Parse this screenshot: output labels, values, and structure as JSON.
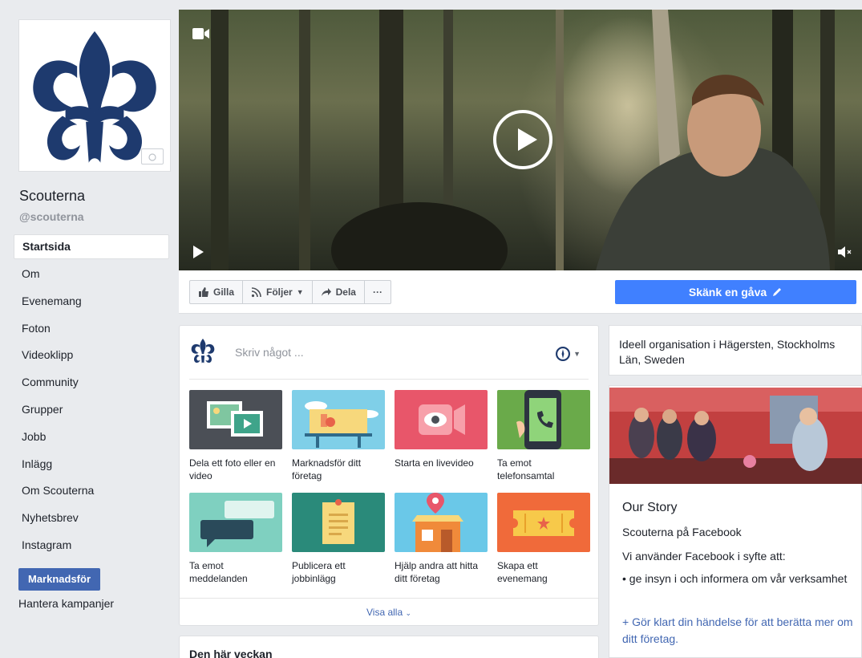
{
  "colors": {
    "brand_blue": "#4267b2",
    "donate_blue": "#4080ff",
    "logo_navy": "#1e3a6e",
    "page_bg": "#e9ebee"
  },
  "page": {
    "name": "Scouterna",
    "handle": "@scouterna"
  },
  "nav": [
    {
      "label": "Startsida",
      "active": true
    },
    {
      "label": "Om"
    },
    {
      "label": "Evenemang"
    },
    {
      "label": "Foton"
    },
    {
      "label": "Videoklipp"
    },
    {
      "label": "Community"
    },
    {
      "label": "Grupper"
    },
    {
      "label": "Jobb"
    },
    {
      "label": "Inlägg"
    },
    {
      "label": "Om Scouterna"
    },
    {
      "label": "Nyhetsbrev"
    },
    {
      "label": "Instagram"
    }
  ],
  "promote_label": "Marknadsför",
  "manage_campaigns": "Hantera kampanjer",
  "cover": {
    "video_icon": "video-camera-icon",
    "play_icon": "play-icon",
    "mute_icon": "speaker-muted-icon"
  },
  "actions": {
    "like": "Gilla",
    "follow": "Följer",
    "share": "Dela",
    "more": "···"
  },
  "donate_label": "Skänk en gåva",
  "composer": {
    "placeholder": "Skriv något ...",
    "tiles": [
      {
        "label": "Dela ett foto eller en video",
        "icon": "photo-video-icon"
      },
      {
        "label": "Marknadsför ditt företag",
        "icon": "billboard-icon"
      },
      {
        "label": "Starta en livevideo",
        "icon": "live-video-icon"
      },
      {
        "label": "Ta emot telefonsamtal",
        "icon": "phone-call-icon"
      },
      {
        "label": "Ta emot meddelanden",
        "icon": "messages-icon"
      },
      {
        "label": "Publicera ett jobbinlägg",
        "icon": "job-post-icon"
      },
      {
        "label": "Hjälp andra att hitta ditt företag",
        "icon": "store-location-icon"
      },
      {
        "label": "Skapa ett evenemang",
        "icon": "event-ticket-icon"
      }
    ],
    "show_all": "Visa alla"
  },
  "this_week": "Den här veckan",
  "about": "Ideell organisation i Hägersten, Stockholms Län, Sweden",
  "story": {
    "title": "Our Story",
    "line1": "Scouterna på Facebook",
    "line2": "Vi använder Facebook i syfte att:",
    "line3": "• ge insyn i och informera om vår verksamhet",
    "link": "+ Gör klart din händelse för att berätta mer om ditt företag."
  }
}
